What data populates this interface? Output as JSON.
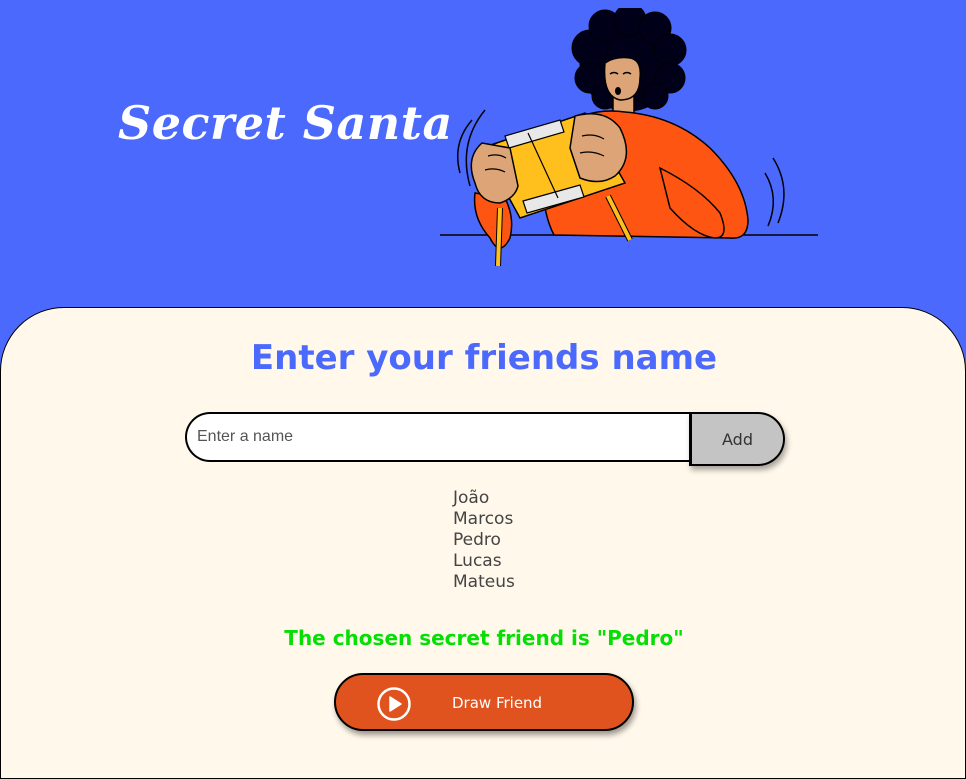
{
  "header": {
    "title": "Secret Santa",
    "illustration": "person-opening-gift-illustration"
  },
  "main": {
    "subtitle": "Enter your friends name",
    "name_input": {
      "placeholder": "Enter a name",
      "value": ""
    },
    "add_button_label": "Add",
    "friends": [
      "João",
      "Marcos",
      "Pedro",
      "Lucas",
      "Mateus"
    ],
    "result_text": "The chosen secret friend is \"Pedro\"",
    "draw_button": {
      "label": "Draw Friend",
      "icon": "play-circle-icon"
    }
  },
  "colors": {
    "background": "#4B69FD",
    "panel": "#FFF8EB",
    "subtitle": "#4B69FD",
    "add_button": "#C4C4C4",
    "result": "#05DF05",
    "draw_button": "#E1531E",
    "sweater": "#FF5512",
    "gift_box": "#FFC01E"
  }
}
